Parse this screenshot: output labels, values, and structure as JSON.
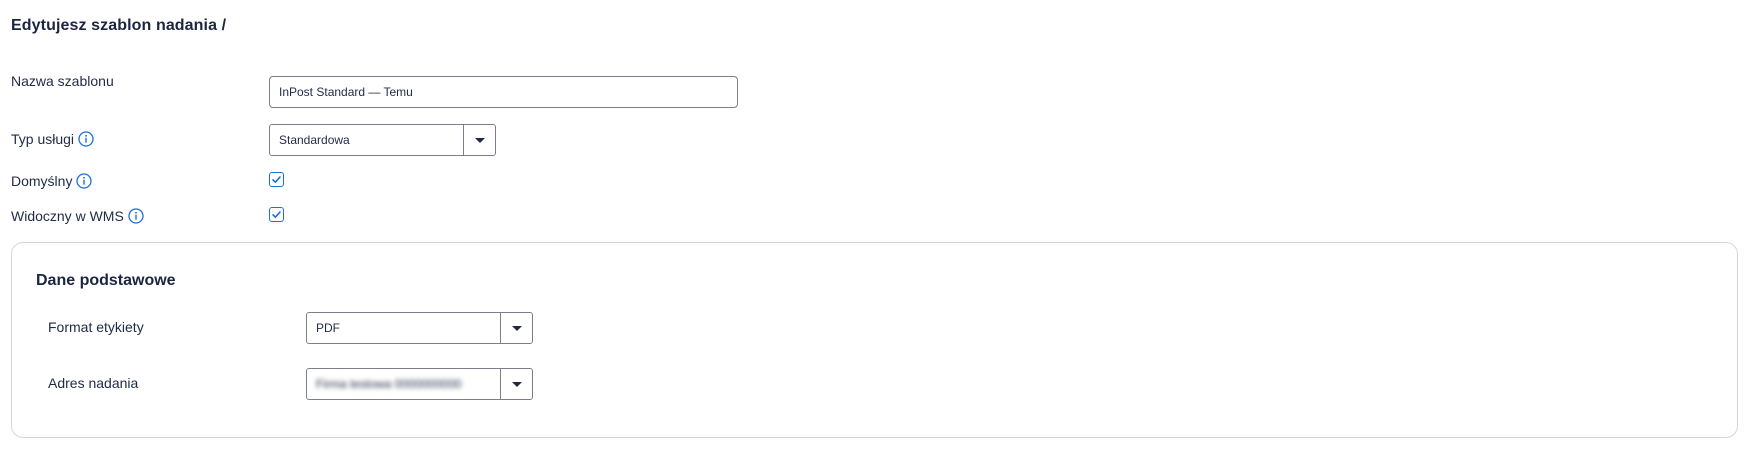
{
  "page": {
    "title": "Edytujesz szablon nadania /"
  },
  "form": {
    "template_name": {
      "label": "Nazwa szablonu",
      "value": "InPost Standard — Temu"
    },
    "service_type": {
      "label": "Typ usługi",
      "value": "Standardowa",
      "icon": "info-icon"
    },
    "default": {
      "label": "Domyślny",
      "checked": true,
      "icon": "info-icon"
    },
    "visible_in_wms": {
      "label": "Widoczny w WMS",
      "checked": true,
      "icon": "info-icon"
    }
  },
  "basic_data": {
    "title": "Dane podstawowe",
    "label_format": {
      "label": "Format etykiety",
      "value": "PDF"
    },
    "sender_address": {
      "label": "Adres nadania",
      "value": "Firma testowa 0000000000"
    }
  },
  "colors": {
    "accent": "#1d6fd6",
    "text": "#1f2a44",
    "border": "#7c7f87",
    "panel_border": "#d3d6dc"
  }
}
